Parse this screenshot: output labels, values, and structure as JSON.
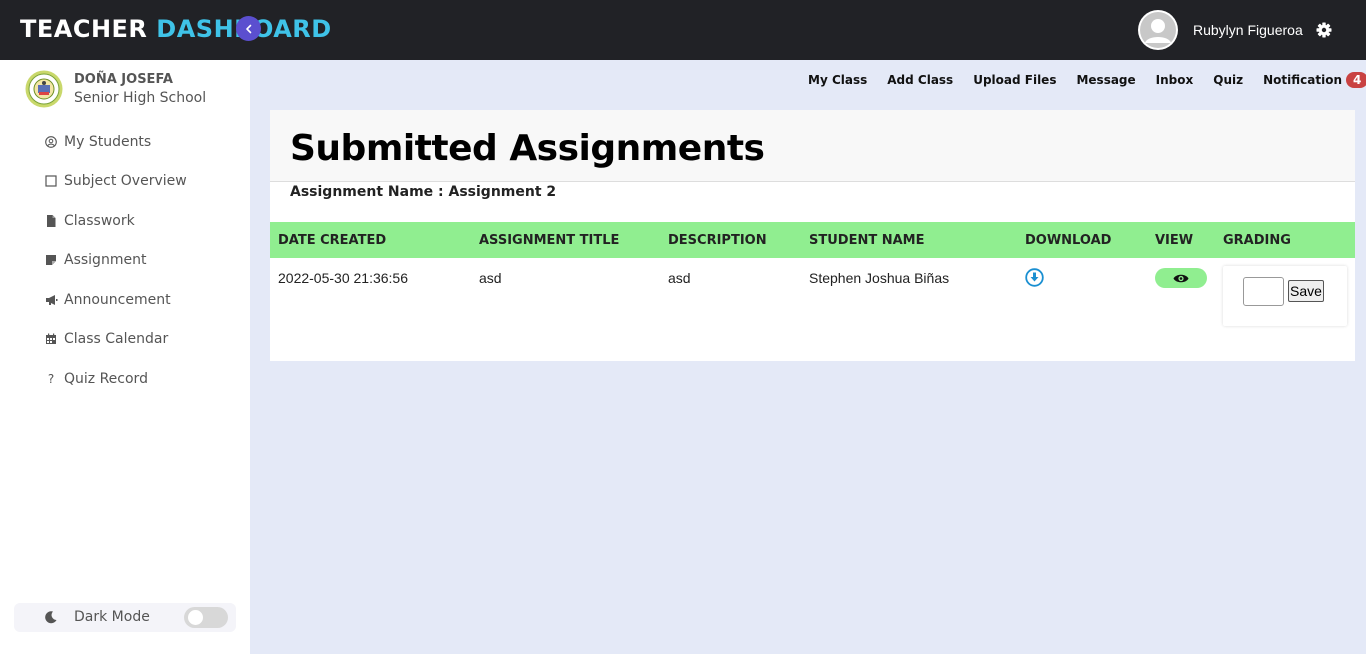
{
  "header": {
    "brand_part1": "TEACHER",
    "brand_part2": "DASHBOARD",
    "user_name": "Rubylyn Figueroa"
  },
  "sidebar": {
    "school_line1": "DOÑA JOSEFA",
    "school_line2": "Senior High School",
    "items": [
      {
        "label": "My Students",
        "icon": "user-circle-icon"
      },
      {
        "label": "Subject Overview",
        "icon": "square-icon"
      },
      {
        "label": "Classwork",
        "icon": "file-icon"
      },
      {
        "label": "Assignment",
        "icon": "sticky-note-icon"
      },
      {
        "label": "Announcement",
        "icon": "bullhorn-icon"
      },
      {
        "label": "Class Calendar",
        "icon": "calendar-icon"
      },
      {
        "label": "Quiz Record",
        "icon": "question-icon"
      }
    ],
    "dark_mode_label": "Dark Mode",
    "dark_mode_on": false
  },
  "topnav": {
    "items": [
      "My Class",
      "Add Class",
      "Upload Files",
      "Message",
      "Inbox",
      "Quiz",
      "Notification"
    ],
    "notification_count": "4"
  },
  "main": {
    "title": "Submitted Assignments",
    "assignment_name": "Assignment Name : Assignment 2",
    "columns": [
      "DATE CREATED",
      "ASSIGNMENT TITLE",
      "DESCRIPTION",
      "STUDENT NAME",
      "DOWNLOAD",
      "VIEW",
      "GRADING"
    ],
    "rows": [
      {
        "date_created": "2022-05-30 21:36:56",
        "assignment_title": "asd",
        "description": "asd",
        "student_name": "Stephen Joshua Biñas",
        "grade": "",
        "save_label": "Save"
      }
    ]
  },
  "colors": {
    "header_bg": "#212226",
    "brand_accent": "#3fc3e8",
    "table_header_bg": "#90ee90",
    "page_bg": "#e4e9f7",
    "badge_bg": "#c94242",
    "toggle_bg": "#5b4fcf",
    "download_icon": "#1a8fd1"
  }
}
